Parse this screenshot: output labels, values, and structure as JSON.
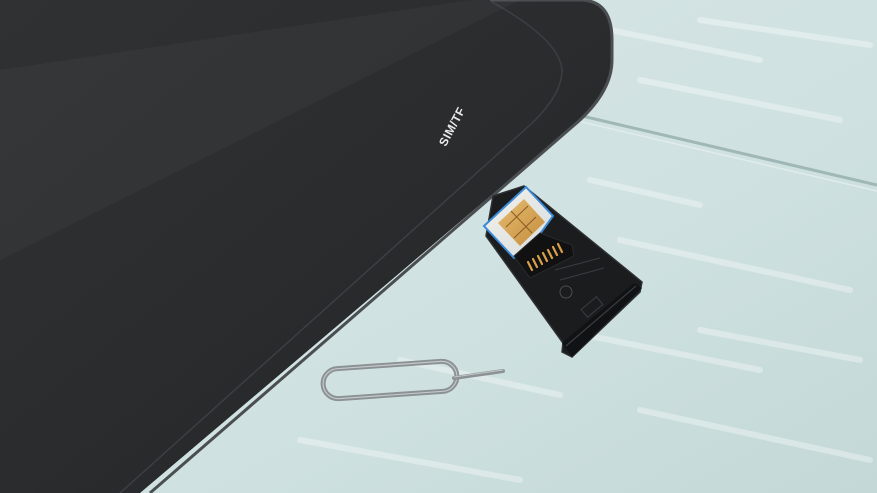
{
  "photo": {
    "port_label": "SIM/TF",
    "icons": [
      "sim-card-icon",
      "microsd-card-icon",
      "sim-eject-pin-icon"
    ],
    "colors": {
      "tablet_body": "#2b2d2f",
      "table_surface": "#d3e4e4",
      "sim_contacts": "#d7a85c",
      "card_tray": "#1b1c1e",
      "eject_pin": "#8c9194"
    }
  }
}
